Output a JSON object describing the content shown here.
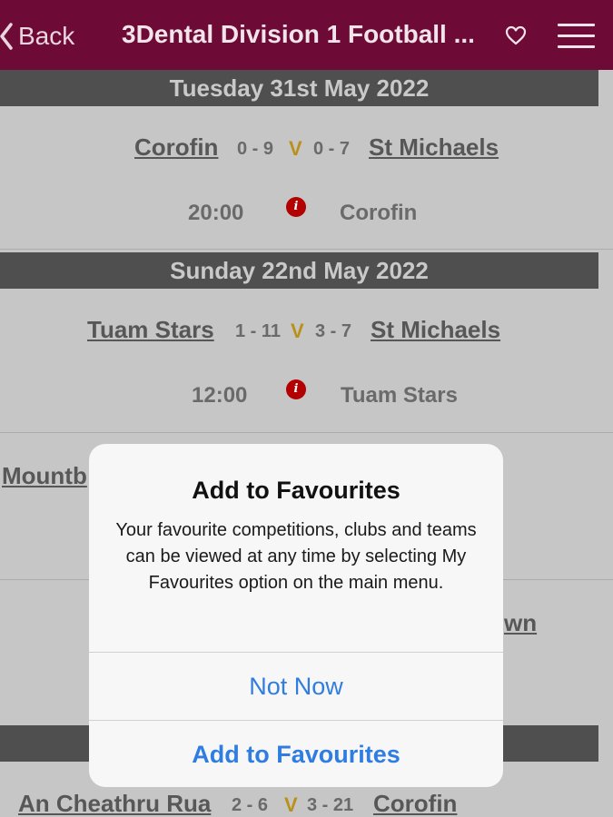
{
  "nav": {
    "back_label": "Back",
    "title": "3Dental Division 1 Football ...",
    "bg_color": "#6d0a36"
  },
  "icons": [
    "chevron-left-icon",
    "heart-icon",
    "hamburger-menu-icon",
    "info-icon"
  ],
  "fixtures": [
    {
      "date": "Tuesday 31st May 2022",
      "home": "Corofin",
      "home_score": "0 - 9",
      "v": "V",
      "away_score": "0 - 7",
      "away": "St Michaels",
      "time": "20:00",
      "venue": "Corofin"
    },
    {
      "date": "Sunday 22nd May 2022",
      "home": "Tuam Stars",
      "home_score": "1 - 11",
      "v": "V",
      "away_score": "3 - 7",
      "away": "St Michaels",
      "time": "12:00",
      "venue": "Tuam Stars"
    }
  ],
  "partial": {
    "row3_home": "Mountb",
    "row4_away_tail": "wn",
    "row5_home": "An Cheathru Rua",
    "row5_home_score": "2 - 6",
    "row5_v": "V",
    "row5_away_score": "3 - 21",
    "row5_away": "Corofin"
  },
  "dialog": {
    "title": "Add to Favourites",
    "message": "Your favourite competitions, clubs and teams can be viewed at any time by selecting My Favourites option on the main menu.",
    "not_now": "Not Now",
    "add": "Add to Favourites",
    "button_color": "#2f7de1"
  }
}
